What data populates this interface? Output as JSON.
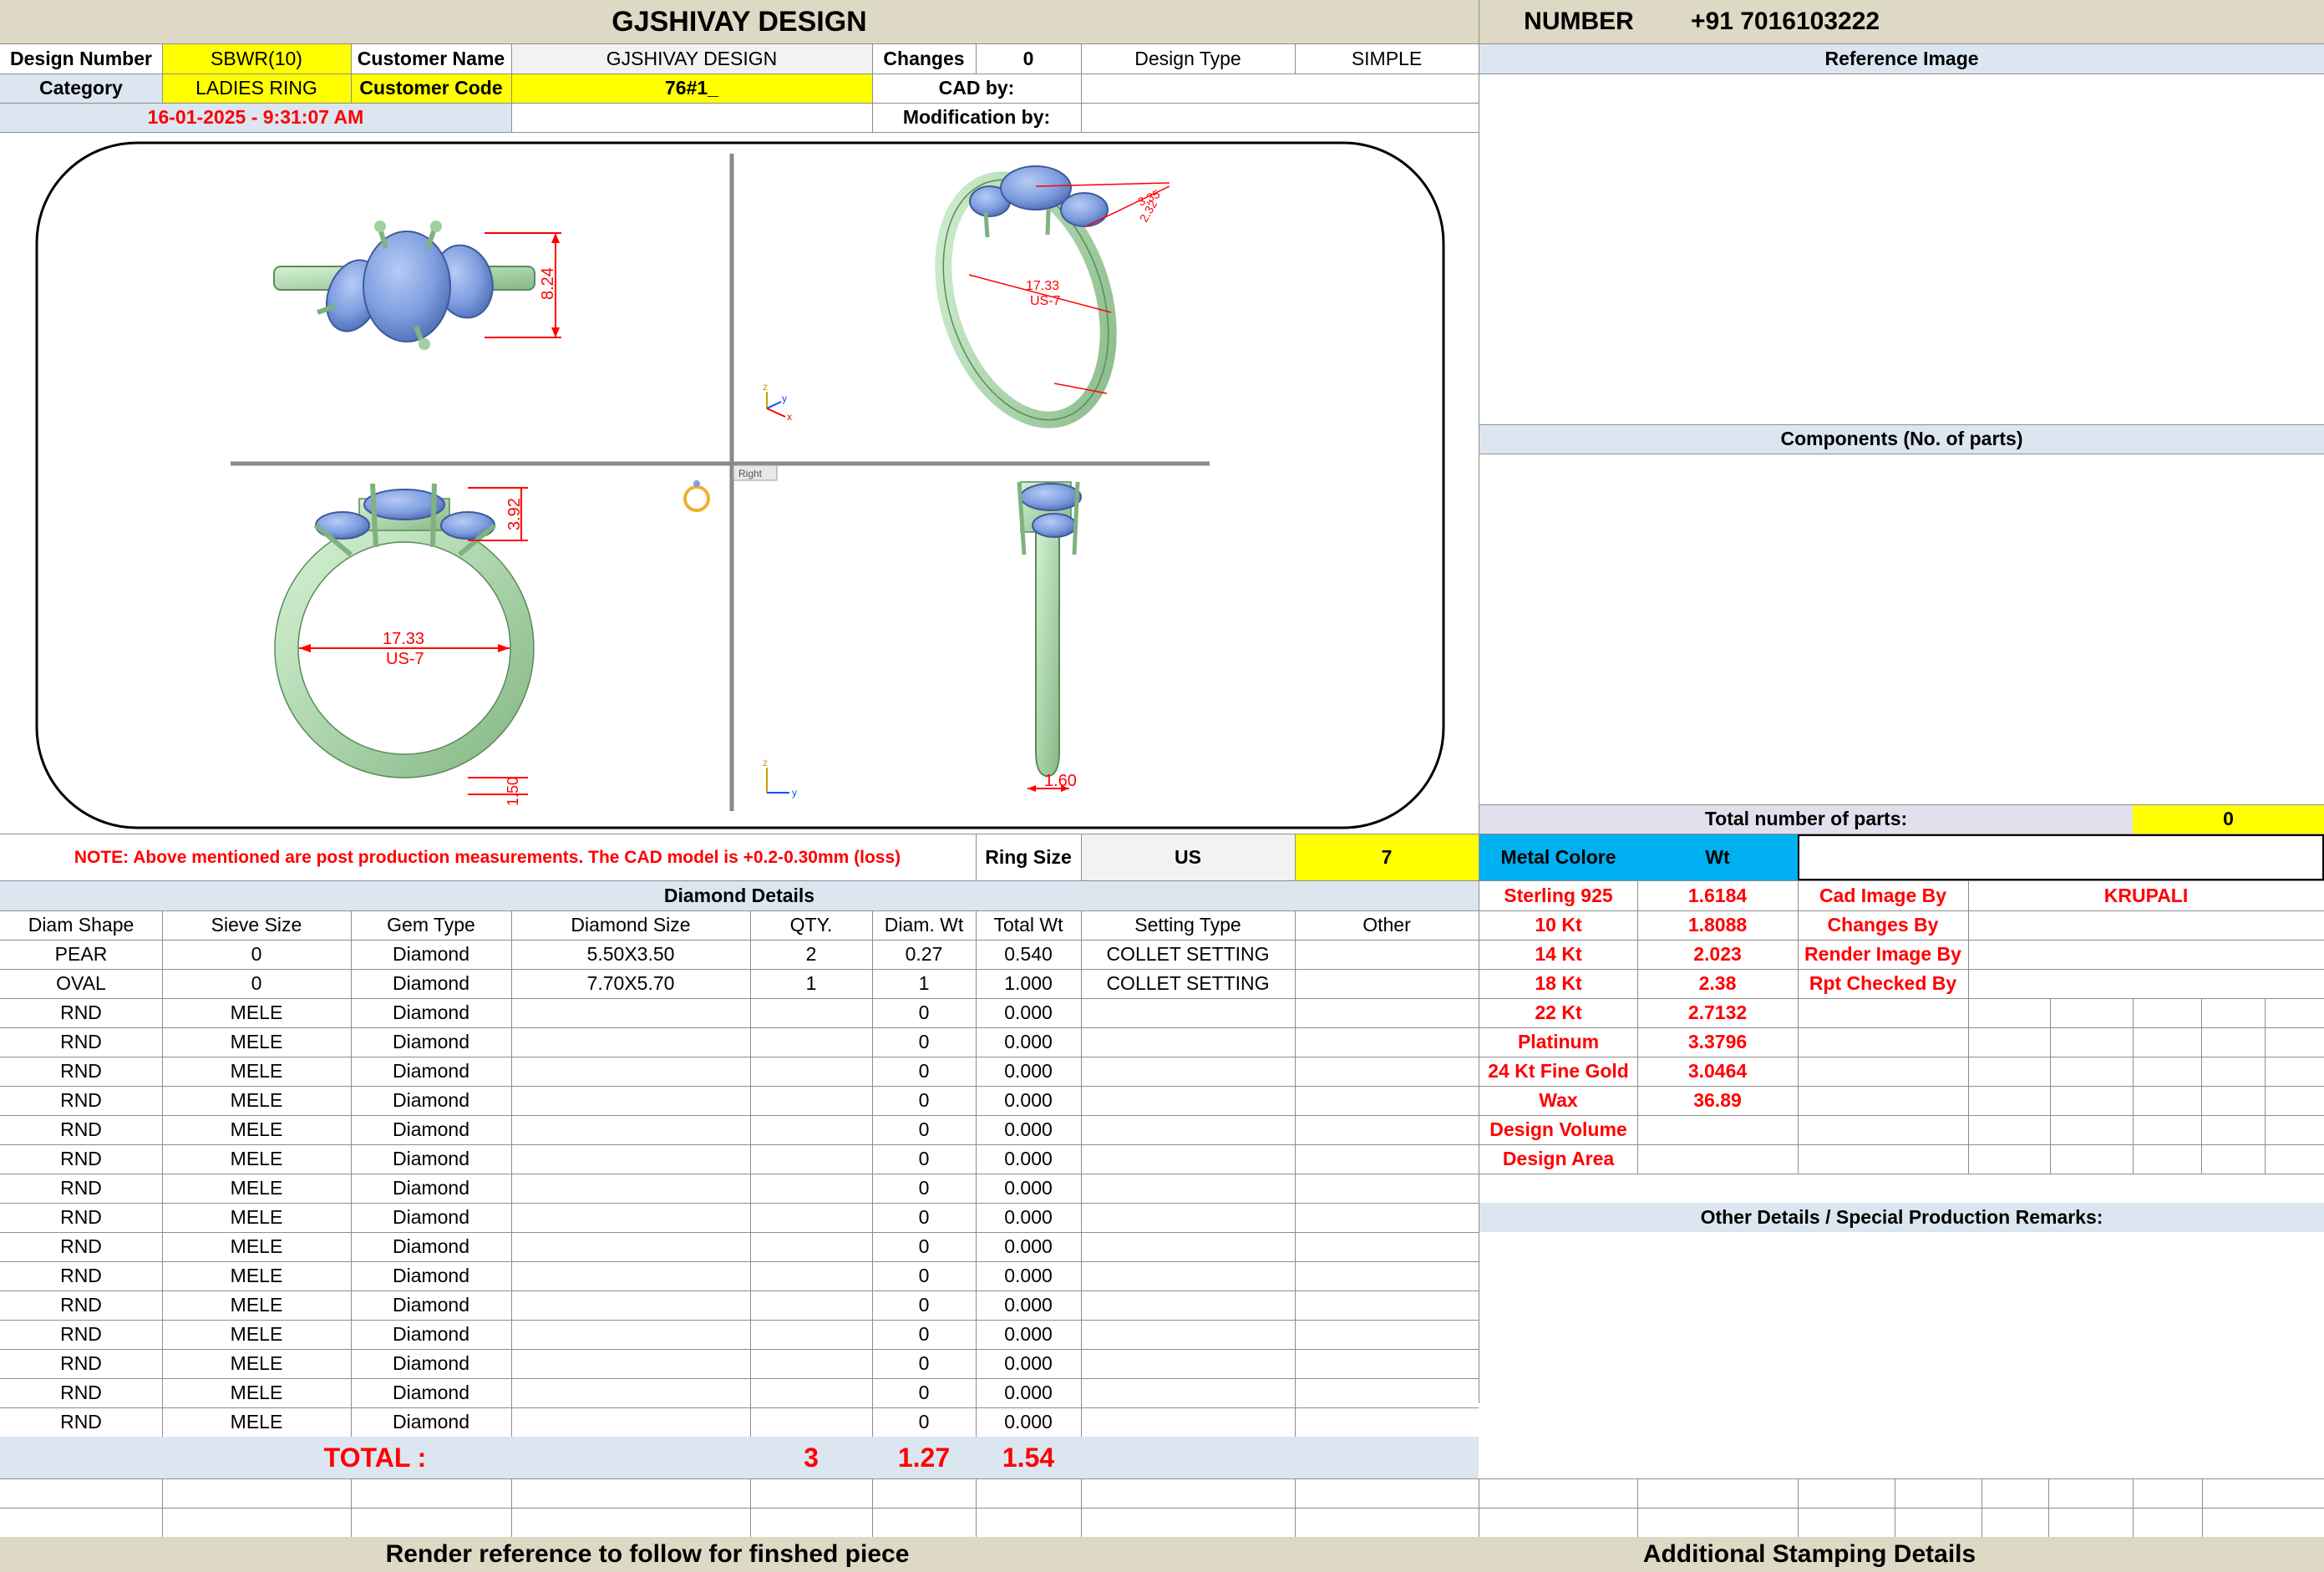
{
  "header": {
    "title": "GJSHIVAY DESIGN",
    "number_label": "NUMBER",
    "number_value": "+91 7016103222"
  },
  "info": {
    "design_number_label": "Design Number",
    "design_number": "SBWR(10)",
    "customer_name_label": "Customer Name",
    "customer_name": "GJSHIVAY DESIGN",
    "changes_label": "Changes",
    "changes": "0",
    "design_type_label": "Design Type",
    "design_type": "SIMPLE",
    "category_label": "Category",
    "category": "LADIES RING",
    "customer_code_label": "Customer Code",
    "customer_code": "76#1_",
    "cad_by_label": "CAD by:",
    "cad_by": "",
    "datetime": "16-01-2025 - 9:31:07 AM",
    "modification_by_label": "Modification by:",
    "modification_by": ""
  },
  "cad": {
    "dim_height": "8.24",
    "dim_size": "17.33",
    "dim_us": "US-7",
    "dim_top": "3.92",
    "dim_bottom": "1.50",
    "dim_width": "1.60",
    "dim_a": "2.32",
    "dim_b": "3.35",
    "view_label": "Right",
    "axis_x": "x",
    "axis_y": "y",
    "axis_z": "z"
  },
  "right_panel": {
    "reference_image": "Reference Image",
    "components": "Components (No. of parts)",
    "total_parts_label": "Total number of parts:",
    "total_parts": "0"
  },
  "note": {
    "text": "NOTE: Above mentioned are post production measurements. The CAD model is +0.2-0.30mm (loss)",
    "ring_size_label": "Ring Size",
    "ring_unit": "US",
    "ring_size": "7"
  },
  "diamond": {
    "title": "Diamond Details",
    "headers": [
      "Diam Shape",
      "Sieve Size",
      "Gem Type",
      "Diamond Size",
      "QTY.",
      "Diam. Wt",
      "Total Wt",
      "Setting Type",
      "Other"
    ],
    "rows": [
      [
        "PEAR",
        "0",
        "Diamond",
        "5.50X3.50",
        "2",
        "0.27",
        "0.540",
        "COLLET SETTING",
        ""
      ],
      [
        "OVAL",
        "0",
        "Diamond",
        "7.70X5.70",
        "1",
        "1",
        "1.000",
        "COLLET SETTING",
        ""
      ],
      [
        "RND",
        "MELE",
        "Diamond",
        "",
        "",
        "0",
        "0.000",
        "",
        ""
      ],
      [
        "RND",
        "MELE",
        "Diamond",
        "",
        "",
        "0",
        "0.000",
        "",
        ""
      ],
      [
        "RND",
        "MELE",
        "Diamond",
        "",
        "",
        "0",
        "0.000",
        "",
        ""
      ],
      [
        "RND",
        "MELE",
        "Diamond",
        "",
        "",
        "0",
        "0.000",
        "",
        ""
      ],
      [
        "RND",
        "MELE",
        "Diamond",
        "",
        "",
        "0",
        "0.000",
        "",
        ""
      ],
      [
        "RND",
        "MELE",
        "Diamond",
        "",
        "",
        "0",
        "0.000",
        "",
        ""
      ],
      [
        "RND",
        "MELE",
        "Diamond",
        "",
        "",
        "0",
        "0.000",
        "",
        ""
      ],
      [
        "RND",
        "MELE",
        "Diamond",
        "",
        "",
        "0",
        "0.000",
        "",
        ""
      ],
      [
        "RND",
        "MELE",
        "Diamond",
        "",
        "",
        "0",
        "0.000",
        "",
        ""
      ],
      [
        "RND",
        "MELE",
        "Diamond",
        "",
        "",
        "0",
        "0.000",
        "",
        ""
      ],
      [
        "RND",
        "MELE",
        "Diamond",
        "",
        "",
        "0",
        "0.000",
        "",
        ""
      ],
      [
        "RND",
        "MELE",
        "Diamond",
        "",
        "",
        "0",
        "0.000",
        "",
        ""
      ],
      [
        "RND",
        "MELE",
        "Diamond",
        "",
        "",
        "0",
        "0.000",
        "",
        ""
      ],
      [
        "RND",
        "MELE",
        "Diamond",
        "",
        "",
        "0",
        "0.000",
        "",
        ""
      ],
      [
        "RND",
        "MELE",
        "Diamond",
        "",
        "",
        "0",
        "0.000",
        "",
        ""
      ]
    ],
    "total_label": "TOTAL :",
    "total_qty": "3",
    "total_diam_wt": "1.27",
    "total_wt": "1.54"
  },
  "metal": {
    "color_label": "Metal Colore",
    "wt_label": "Wt",
    "rows": [
      {
        "name": "Sterling 925",
        "wt": "1.6184"
      },
      {
        "name": "10 Kt",
        "wt": "1.8088"
      },
      {
        "name": "14 Kt",
        "wt": "2.023"
      },
      {
        "name": "18 Kt",
        "wt": "2.38"
      },
      {
        "name": "22 Kt",
        "wt": "2.7132"
      },
      {
        "name": "Platinum",
        "wt": "3.3796"
      },
      {
        "name": "24 Kt Fine Gold",
        "wt": "3.0464"
      },
      {
        "name": "Wax",
        "wt": "36.89"
      },
      {
        "name": "Design Volume",
        "wt": ""
      },
      {
        "name": "Design Area",
        "wt": ""
      }
    ],
    "cad_image_by_label": "Cad Image By",
    "cad_image_by": "KRUPALI",
    "changes_by_label": "Changes By",
    "render_image_by_label": "Render Image By",
    "rpt_checked_by_label": "Rpt Checked By"
  },
  "remarks": {
    "title": "Other Details / Special Production Remarks:"
  },
  "footer": {
    "render_reference": "Render reference to follow for finshed piece",
    "stamping": "Additional Stamping Details"
  },
  "colors": {
    "yellow": "#ffff00",
    "light_blue": "#dce6f1",
    "metal_header": "#00b0f0",
    "header_bg": "#ddd9c4",
    "metal_green": "#b5e6b5",
    "gem_blue": "#7f9fe0",
    "dimension_red": "#ff0000"
  }
}
